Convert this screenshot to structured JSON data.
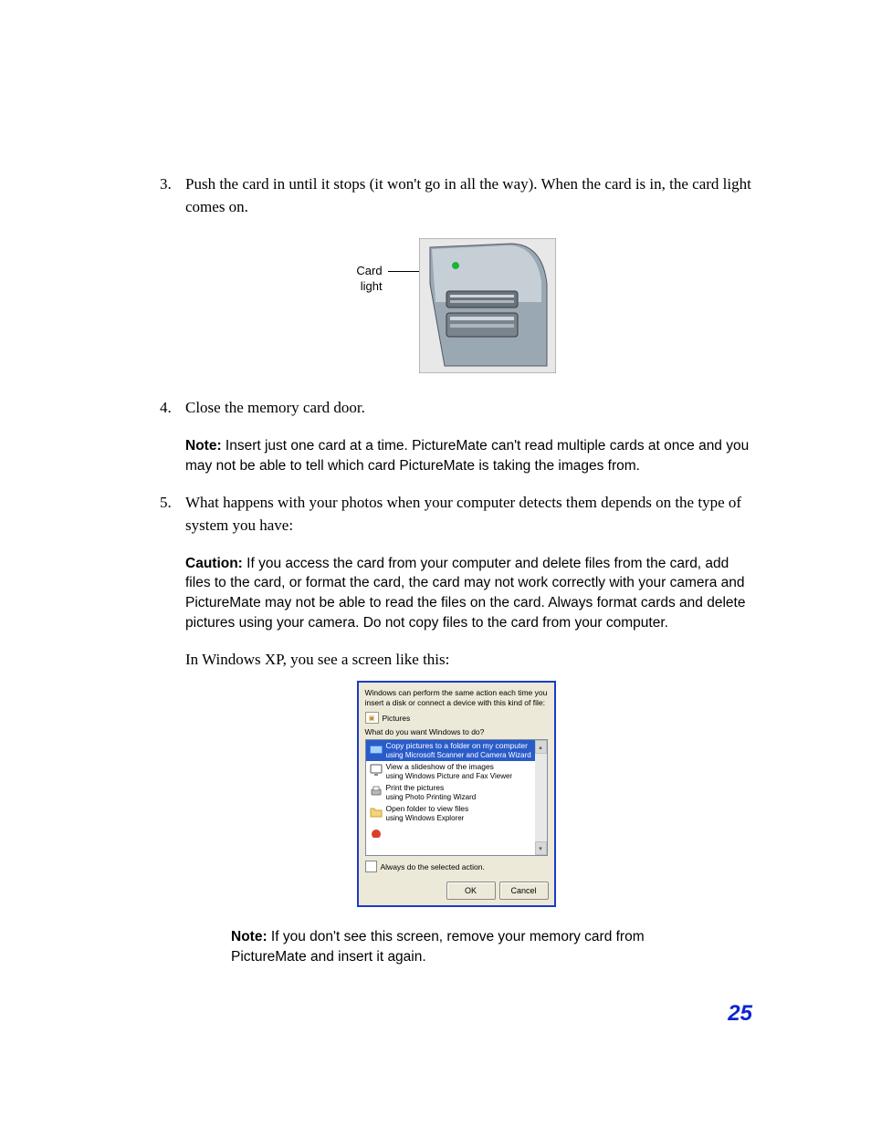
{
  "steps": {
    "s3": {
      "num": "3.",
      "text": "Push the card in until it stops (it won't go in all the way). When the card is in, the card light comes on."
    },
    "s4": {
      "num": "4.",
      "text": "Close the memory card door."
    },
    "s5": {
      "num": "5.",
      "text": "What happens with your photos when your computer detects them depends on the type of system you have:"
    }
  },
  "figure": {
    "label_line1": "Card",
    "label_line2": "light"
  },
  "note1": {
    "label": "Note:",
    "text": " Insert just one card at a time. PictureMate can't read multiple cards at once and you may not be able to tell which card PictureMate is taking the images from."
  },
  "caution": {
    "label": "Caution:",
    "text": " If you access the card from your computer and delete files from the card, add files to the card, or format the card, the card may not work correctly with your camera and PictureMate may not be able to read the files on the card. Always format cards and delete pictures using your camera. Do not copy files to the card from your computer."
  },
  "intro_xp": "In Windows XP, you see a screen like this:",
  "dialog": {
    "intro": "Windows can perform the same action each time you insert a disk or connect a device with this kind of file:",
    "type_label": "Pictures",
    "prompt": "What do you want Windows to do?",
    "items": [
      {
        "t1": "Copy pictures to a folder on my computer",
        "t2": "using Microsoft Scanner and Camera Wizard"
      },
      {
        "t1": "View a slideshow of the images",
        "t2": "using Windows Picture and Fax Viewer"
      },
      {
        "t1": "Print the pictures",
        "t2": "using Photo Printing Wizard"
      },
      {
        "t1": "Open folder to view files",
        "t2": "using Windows Explorer"
      }
    ],
    "always": "Always do the selected action.",
    "ok": "OK",
    "cancel": "Cancel"
  },
  "note2": {
    "label": "Note:",
    "text": " If you don't see this screen, remove your memory card from PictureMate and insert it again."
  },
  "page_number": "25"
}
